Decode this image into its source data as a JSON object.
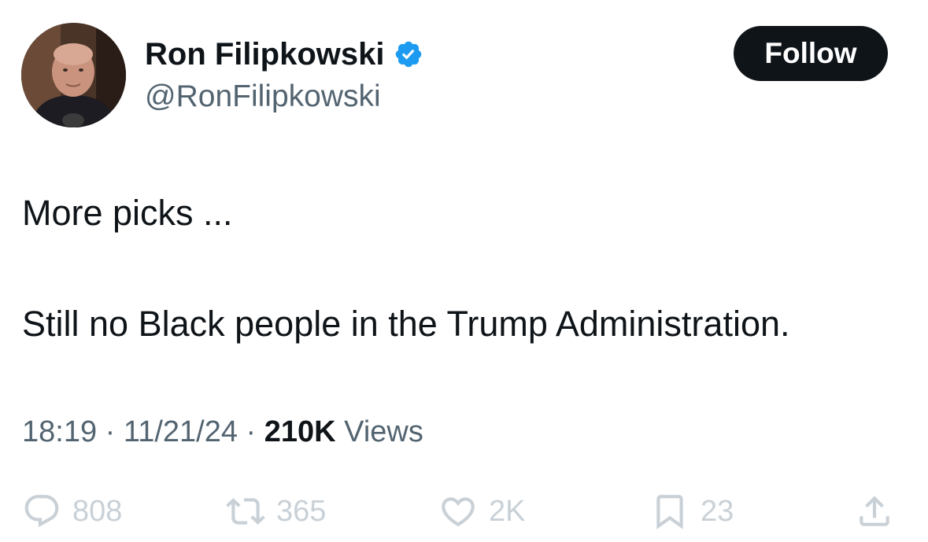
{
  "author": {
    "display_name": "Ron Filipkowski",
    "handle": "@RonFilipkowski",
    "verified": true,
    "verified_color": "#1d9bf0"
  },
  "follow_button": {
    "label": "Follow"
  },
  "tweet": {
    "lines": [
      "More picks ...",
      "Still no Black people in the Trump Administration."
    ]
  },
  "meta": {
    "time": "18:19",
    "separator": "·",
    "date": "11/21/24",
    "views_count": "210K",
    "views_label": "Views"
  },
  "actions": {
    "replies": {
      "count": "808",
      "icon": "reply-icon"
    },
    "reposts": {
      "count": "365",
      "icon": "repost-icon"
    },
    "likes": {
      "count": "2K",
      "icon": "heart-icon"
    },
    "bookmarks": {
      "count": "23",
      "icon": "bookmark-icon"
    },
    "share": {
      "icon": "share-icon"
    }
  },
  "colors": {
    "text_primary": "#0f1419",
    "text_secondary": "#536471",
    "action_muted": "#c9d1d7",
    "follow_bg": "#0f1419"
  }
}
